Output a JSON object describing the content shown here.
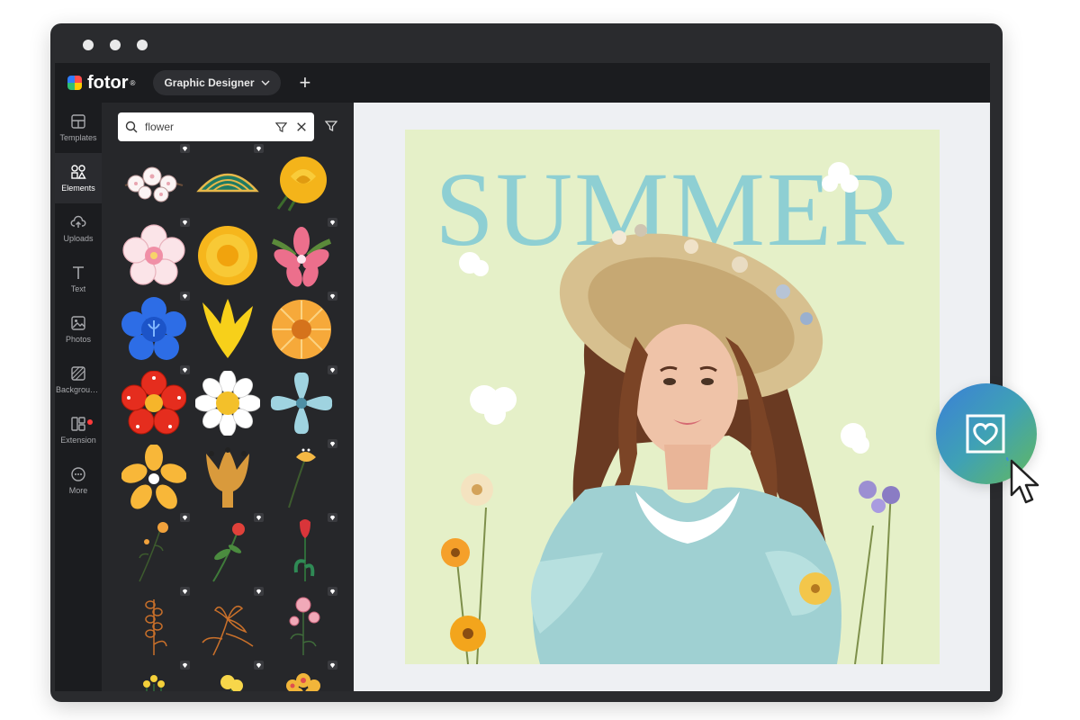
{
  "app": {
    "brand": "fotor",
    "brand_mark": "®",
    "mode_label": "Graphic Designer",
    "add_label": "+"
  },
  "rail": {
    "items": [
      {
        "label": "Templates",
        "icon": "templates-icon",
        "active": false
      },
      {
        "label": "Elements",
        "icon": "elements-icon",
        "active": true
      },
      {
        "label": "Uploads",
        "icon": "upload-icon",
        "active": false
      },
      {
        "label": "Text",
        "icon": "text-icon",
        "active": false
      },
      {
        "label": "Photos",
        "icon": "photo-icon",
        "active": false
      },
      {
        "label": "Backgroun...",
        "icon": "background-icon",
        "active": false
      },
      {
        "label": "Extension",
        "icon": "extension-icon",
        "active": false
      },
      {
        "label": "More",
        "icon": "more-icon",
        "active": false
      }
    ]
  },
  "panel": {
    "search_value": "flower",
    "elements": [
      "white-blossom-branch",
      "green-pine-bough",
      "yellow-rose",
      "pink-cherry-blossom",
      "yellow-chrysanthemum",
      "pink-lily",
      "blue-flower",
      "yellow-tulip",
      "orange-daisy",
      "red-flower",
      "white-daisy",
      "light-blue-flower",
      "orange-daisy-simple",
      "orange-tulip",
      "orange-flower-stem",
      "orange-flower-sprig",
      "red-flower-sprig",
      "red-tulip-sprig",
      "orange-lavender-sketch",
      "orange-lily-sketch",
      "pink-flower-sketch",
      "yellow-flower-cluster",
      "yellow-flower-small",
      "orange-flower-bunch"
    ]
  },
  "canvas": {
    "headline": "SUMMER"
  },
  "colors": {
    "accent": "#3fa1b5",
    "canvas_bg": "#e5f0c8",
    "headline": "#8ecfd3"
  }
}
